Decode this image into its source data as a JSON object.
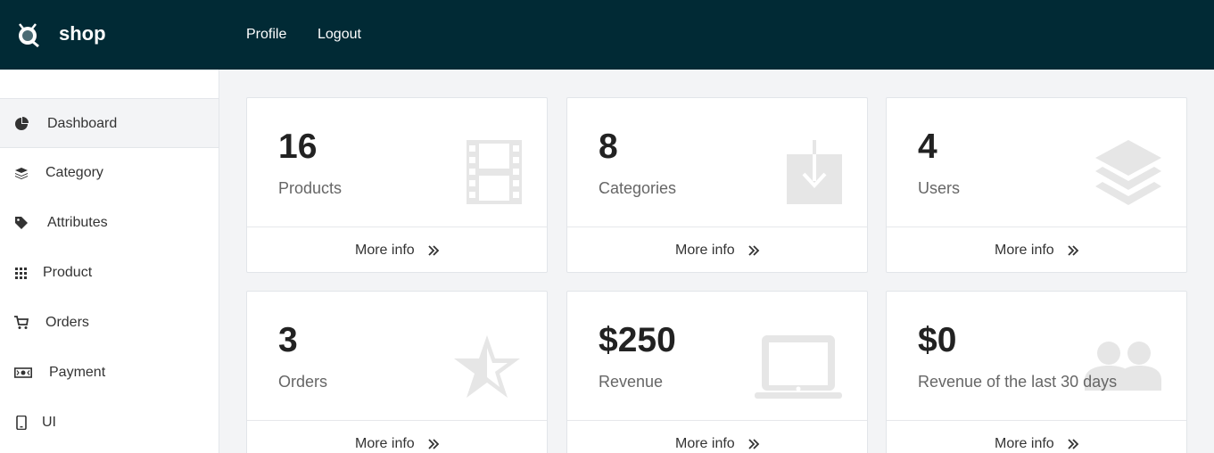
{
  "header": {
    "brand": "shop",
    "nav": {
      "profile": "Profile",
      "logout": "Logout"
    }
  },
  "sidebar": {
    "items": [
      {
        "label": "Dashboard",
        "icon": "pie-chart-icon",
        "active": true
      },
      {
        "label": "Category",
        "icon": "layers-icon"
      },
      {
        "label": "Attributes",
        "icon": "tag-icon"
      },
      {
        "label": "Product",
        "icon": "grid-icon"
      },
      {
        "label": "Orders",
        "icon": "cart-icon"
      },
      {
        "label": "Payment",
        "icon": "money-icon"
      },
      {
        "label": "UI",
        "icon": "mobile-icon"
      }
    ]
  },
  "cards": [
    {
      "value": "16",
      "label": "Products",
      "icon": "film-icon",
      "more": "More info"
    },
    {
      "value": "8",
      "label": "Categories",
      "icon": "download-icon",
      "more": "More info"
    },
    {
      "value": "4",
      "label": "Users",
      "icon": "layers-icon",
      "more": "More info"
    },
    {
      "value": "3",
      "label": "Orders",
      "icon": "star-icon",
      "more": "More info"
    },
    {
      "value": "$250",
      "label": "Revenue",
      "icon": "laptop-icon",
      "more": "More info"
    },
    {
      "value": "$0",
      "label": "Revenue of the last 30 days",
      "icon": "users-icon",
      "more": "More info"
    }
  ],
  "colors": {
    "topbar": "#012a35",
    "sidebar_bg": "#ffffff",
    "content_bg": "#f3f4f6",
    "card_icon": "#e6e6e6"
  }
}
